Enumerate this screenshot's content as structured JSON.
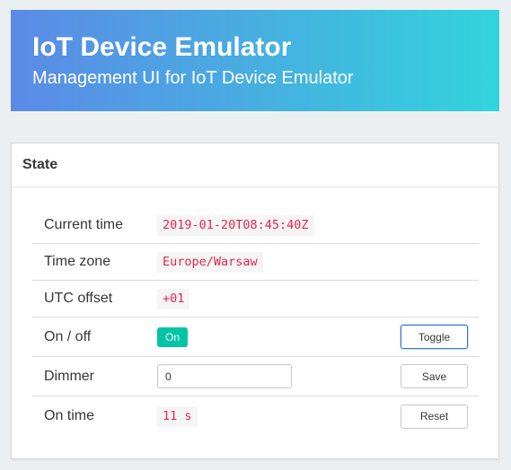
{
  "header": {
    "title": "IoT Device Emulator",
    "subtitle": "Management UI for IoT Device Emulator"
  },
  "state_card": {
    "title": "State",
    "rows": [
      {
        "label": "Current time",
        "value": "2019-01-20T08:45:40Z"
      },
      {
        "label": "Time zone",
        "value": "Europe/Warsaw"
      },
      {
        "label": "UTC offset",
        "value": "+01"
      },
      {
        "label": "On / off",
        "value": "On",
        "action_label": "Toggle"
      },
      {
        "label": "Dimmer",
        "input_value": "0",
        "action_label": "Save"
      },
      {
        "label": "On time",
        "value": "11 s",
        "action_label": "Reset"
      }
    ]
  },
  "colors": {
    "hero_gradient_start": "#5b8ae6",
    "hero_gradient_end": "#32d4dc",
    "code_text": "#e5264f",
    "on_tag": "#00c4a7",
    "focus_border": "#3273dc"
  }
}
